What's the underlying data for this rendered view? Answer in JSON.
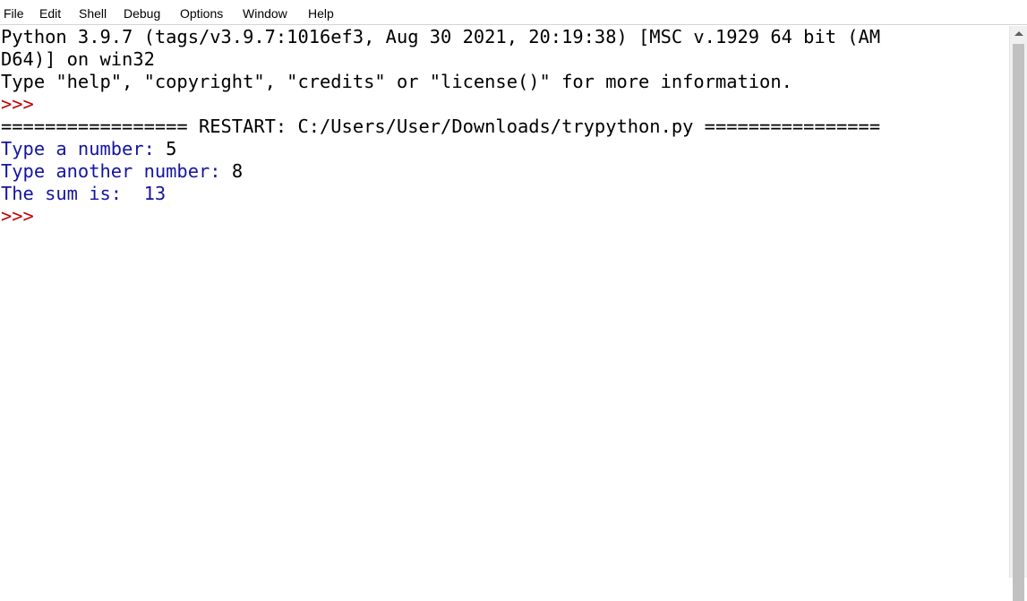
{
  "menubar": {
    "items": [
      {
        "label": "File"
      },
      {
        "label": "Edit"
      },
      {
        "label": "Shell"
      },
      {
        "label": "Debug"
      },
      {
        "label": "Options"
      },
      {
        "label": "Window"
      },
      {
        "label": "Help"
      }
    ]
  },
  "shell": {
    "banner_line1": "Python 3.9.7 (tags/v3.9.7:1016ef3, Aug 30 2021, 20:19:38) [MSC v.1929 64 bit (AM",
    "banner_line2": "D64)] on win32",
    "banner_line3": "Type \"help\", \"copyright\", \"credits\" or \"license()\" for more information.",
    "prompt": ">>>",
    "restart_line": "================= RESTART: C:/Users/User/Downloads/trypython.py ================",
    "input1": {
      "prompt_text": "Type a number: ",
      "value": "5"
    },
    "input2": {
      "prompt_text": "Type another number: ",
      "value": "8"
    },
    "output": "The sum is:  13",
    "final_prompt": ">>>"
  },
  "colors": {
    "prompt": "#c00000",
    "stdout": "#1515a0",
    "stdin": "#000000"
  }
}
